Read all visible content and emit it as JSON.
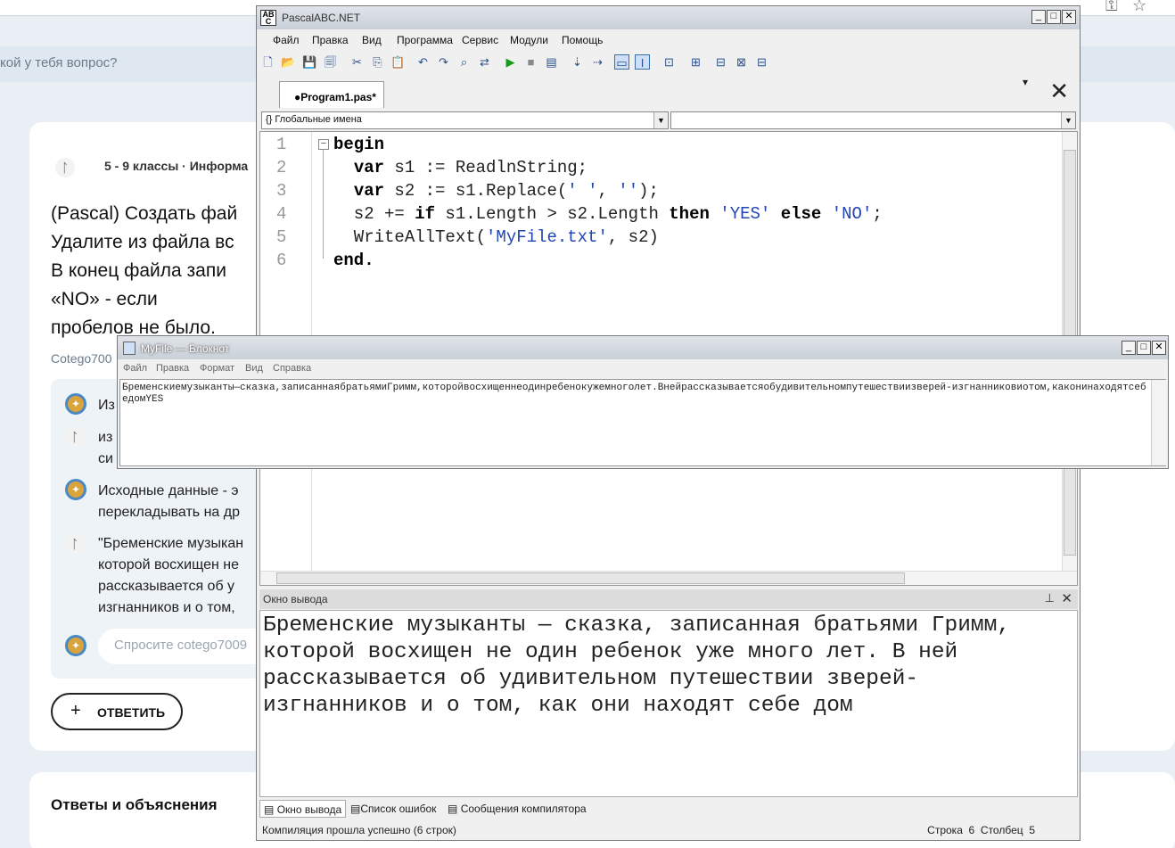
{
  "web": {
    "search_placeholder": "кой у тебя вопрос?",
    "meta": "5 - 9 классы · Информа",
    "question_lines": [
      "(Pascal) Создать фай",
      "Удалите из файла вс",
      "В конец файла запи",
      "«NO» - если",
      "пробелов не было."
    ],
    "author": "Cotego700",
    "comments": [
      {
        "lines": [
          "Из"
        ]
      },
      {
        "lines": [
          "из",
          "си"
        ]
      },
      {
        "lines": [
          "Исходные данные - э",
          "перекладывать на др"
        ]
      },
      {
        "lines": [
          "\"Бременские музыкан",
          "которой восхищен не",
          "рассказывается об у",
          "изгнанников и о том,"
        ]
      }
    ],
    "ask_placeholder": "Спросите cotego7009",
    "answer_button": "ОТВЕТИТЬ",
    "answers_title": "Ответы и объяснения"
  },
  "ide": {
    "title": "PascalABC.NET",
    "menu": [
      "Файл",
      "Правка",
      "Вид",
      "Программа",
      "Сервис",
      "Модули",
      "Помощь"
    ],
    "tab_label": "●Program1.pas*",
    "combo_left": "Глобальные имена",
    "combo_right": "",
    "line_numbers": [
      "1",
      "2",
      "3",
      "4",
      "5",
      "6"
    ],
    "output_title": "Окно вывода",
    "output_lines": [
      "Бременские музыканты — сказка, записанная братьями Гримм,",
      "которой восхищен не один ребенок уже много лет. В ней",
      "рассказывается об удивительном путешествии зверей-",
      "изгнанников и о том, как они находят себе дом"
    ],
    "bottom_tabs": [
      "Окно вывода",
      "Список ошибок",
      "Сообщения компилятора"
    ],
    "status": "Компиляция прошла успешно (6 строк)",
    "row_label": "Строка",
    "row_value": "6",
    "col_label": "Столбец",
    "col_value": "5"
  },
  "notepad": {
    "title": "MyFile — Блокнот",
    "menu": [
      "Файл",
      "Правка",
      "Формат",
      "Вид",
      "Справка"
    ],
    "content": "Бременскиемузыканты—сказка,записаннаябратьямиГримм,которойвосхищеннеодинребенокужемноголет.Внейрассказываетсяобудивительномпутешествиизверей-изгнанниковиотом,каконинаходятсебедомYES"
  }
}
